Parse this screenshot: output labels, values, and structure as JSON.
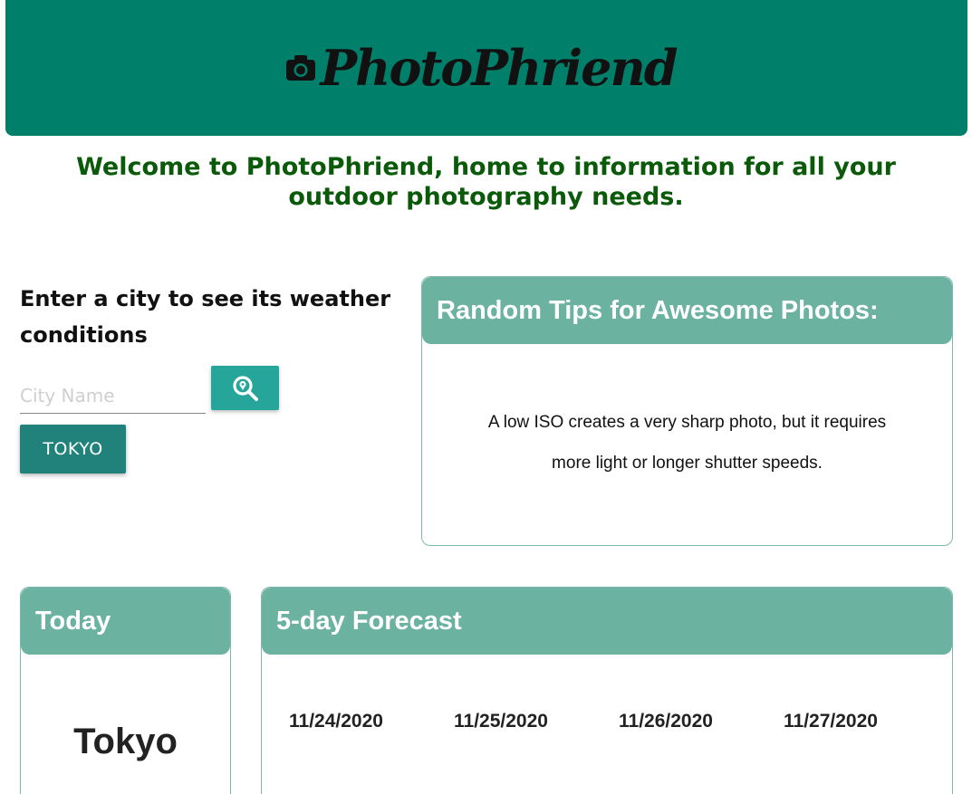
{
  "header": {
    "brand": "PhotoPhriend",
    "brand_icon": "camera-icon",
    "bg_color": "#00806a"
  },
  "welcome": "Welcome to PhotoPhriend, home to information for all your outdoor photography needs.",
  "search": {
    "heading": "Enter a city to see its weather conditions",
    "placeholder": "City Name",
    "value": "",
    "search_icon": "search-location-icon",
    "saved_city": "TOKYO"
  },
  "tips": {
    "title": "Random Tips for Awesome Photos:",
    "text": "A low ISO creates a very sharp photo, but it requires more light or longer shutter speeds."
  },
  "today": {
    "title": "Today",
    "city": "Tokyo"
  },
  "forecast": {
    "title": "5-day Forecast",
    "dates": [
      "11/24/2020",
      "11/25/2020",
      "11/26/2020",
      "11/27/2020"
    ]
  },
  "colors": {
    "card_header": "#6bb2a0",
    "button": "#26a69a",
    "saved_button": "#20827a",
    "welcome_text": "#0a5a0a"
  }
}
